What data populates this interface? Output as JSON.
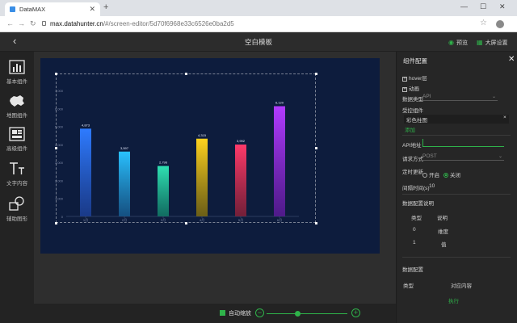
{
  "browser": {
    "tab_title": "DataMAX",
    "url_host": "max.datahunter.cn",
    "url_path": "/#/screen-editor/5d70f6968e33c6526e0ba2d5"
  },
  "header": {
    "title": "空白模板",
    "preview_label": "预览",
    "screen_settings_label": "大屏设置"
  },
  "sidebar": {
    "items": [
      {
        "label": "基本组件",
        "icon": "bar-chart-icon"
      },
      {
        "label": "地图组件",
        "icon": "map-icon"
      },
      {
        "label": "高级组件",
        "icon": "advanced-chart-icon"
      },
      {
        "label": "文字内容",
        "icon": "text-icon"
      },
      {
        "label": "辅助图形",
        "icon": "shapes-icon"
      }
    ]
  },
  "chart_data": {
    "type": "bar",
    "categories": [
      "1月",
      "2月",
      "3月",
      "4月",
      "5月",
      "6月"
    ],
    "values": [
      4.873,
      3.597,
      2.796,
      4.315,
      3.992,
      6.12
    ],
    "data_labels": [
      "4,873",
      "3,597",
      "2,796",
      "4,315",
      "3,992",
      "6,120"
    ],
    "y_ticks": [
      "0",
      "1,000",
      "2,000",
      "3,000",
      "4,000",
      "5,000",
      "6,000",
      "7,000"
    ],
    "ylim": [
      0,
      7
    ],
    "colors": [
      [
        "#2e7bff",
        "#1c3f95"
      ],
      [
        "#29c1ff",
        "#16598d"
      ],
      [
        "#2fe0b2",
        "#127a67"
      ],
      [
        "#ffd21e",
        "#7c6a10"
      ],
      [
        "#ff3a6a",
        "#842038"
      ],
      [
        "#b13bff",
        "#5a1a97"
      ]
    ],
    "grid": false,
    "xlabel": "",
    "ylabel": ""
  },
  "bottom": {
    "auto_zoom_label": "自动缩放",
    "zoom_level": 0.38
  },
  "panel": {
    "title": "组件配置",
    "hover_layer": "hover层",
    "animation": "动画",
    "data_type_label": "数据类型",
    "data_type_value": "API",
    "controlled_label": "受控组件",
    "controlled_item": "彩色柱图",
    "add_label": "添加",
    "api_label": "API地址",
    "method_label": "请求方式",
    "method_value": "POST",
    "refresh_label": "定时更新",
    "refresh_on": "开启",
    "refresh_off": "关闭",
    "interval_label": "间隔时间(s)",
    "interval_value": "10",
    "data_desc_title": "数据配置说明",
    "desc_col_type": "类型",
    "desc_col_note": "说明",
    "desc_rows": [
      {
        "type": "0",
        "note": "维度"
      },
      {
        "type": "1",
        "note": "值"
      }
    ],
    "data_config_title": "数据配置",
    "cfg_col_type": "类型",
    "cfg_col_content": "对应内容",
    "execute_label": "执行"
  }
}
